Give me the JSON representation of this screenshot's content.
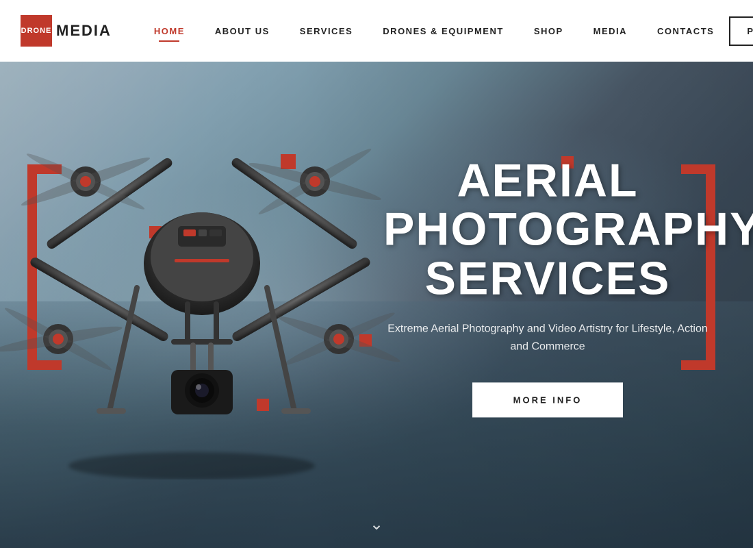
{
  "logo": {
    "drone_text": "DRONE",
    "media_text": "MEDIA"
  },
  "nav": {
    "items": [
      {
        "label": "HOME",
        "active": true
      },
      {
        "label": "ABOUT US",
        "active": false
      },
      {
        "label": "SERVICES",
        "active": false
      },
      {
        "label": "DRONES & EQUIPMENT",
        "active": false
      },
      {
        "label": "SHOP",
        "active": false
      },
      {
        "label": "MEDIA",
        "active": false
      },
      {
        "label": "CONTACTS",
        "active": false
      }
    ],
    "portfolio_label": "PORTFOLIO"
  },
  "hero": {
    "title_line1": "AERIAL PHOTOGRAPHY",
    "title_line2": "SERVICES",
    "subtitle": "Extreme Aerial Photography and Video Artistry for Lifestyle, Action and Commerce",
    "cta_label": "MORE INFO"
  },
  "colors": {
    "accent": "#c0392b",
    "text_dark": "#222222",
    "text_white": "#ffffff"
  }
}
